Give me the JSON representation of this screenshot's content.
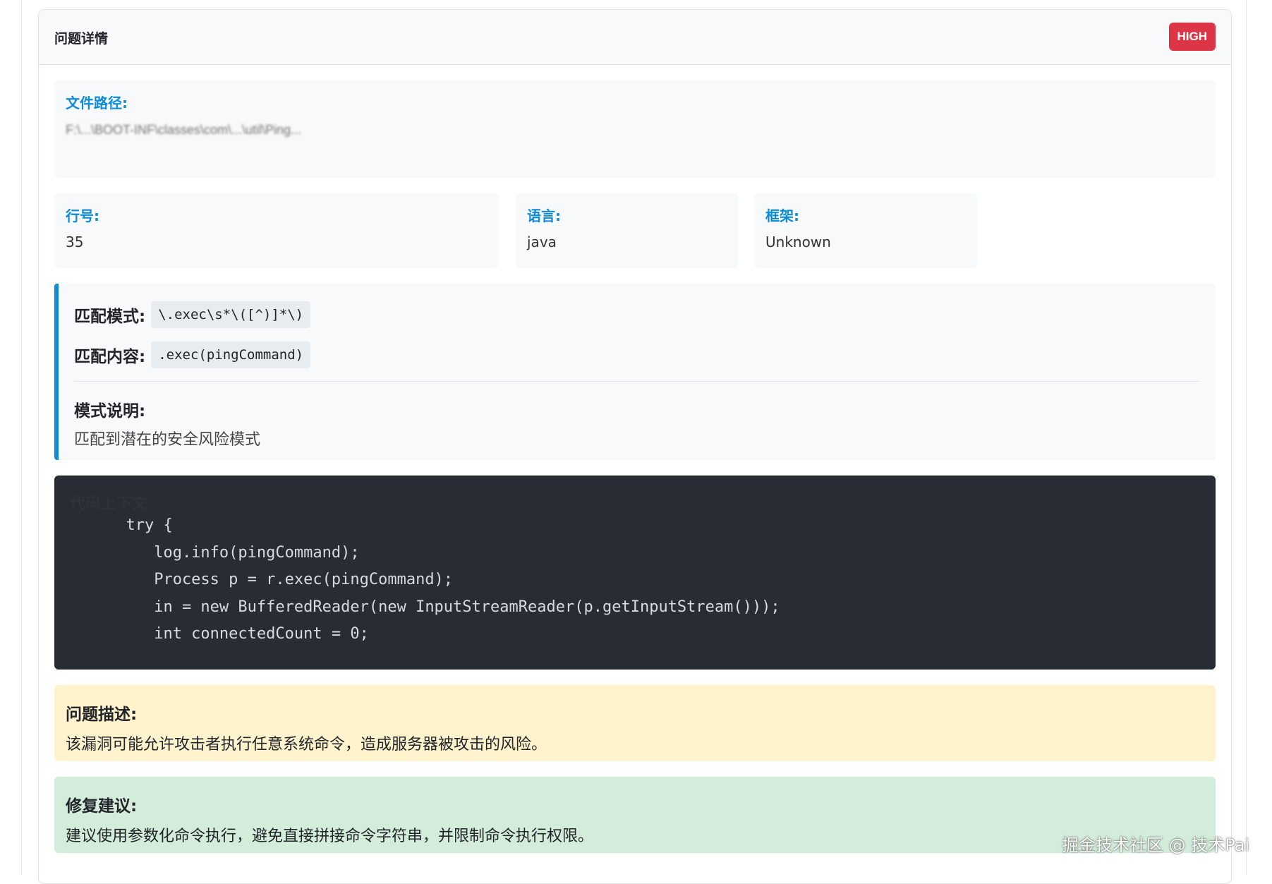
{
  "header": {
    "title": "问题详情",
    "severity": "HIGH"
  },
  "file": {
    "label": "文件路径:",
    "value": "F:\\...\\BOOT-INF\\classes\\com\\...\\util\\Ping..."
  },
  "meta": {
    "line_label": "行号:",
    "line_value": "35",
    "language_label": "语言:",
    "language_value": "java",
    "framework_label": "框架:",
    "framework_value": "Unknown"
  },
  "pattern": {
    "pattern_label": "匹配模式:",
    "pattern_value": "\\.exec\\s*\\([^)]*\\)",
    "content_label": "匹配内容:",
    "content_value": ".exec(pingCommand)",
    "explain_label": "模式说明:",
    "explain_text": "匹配到潜在的安全风险模式"
  },
  "code": {
    "title": "代码上下文",
    "lines": [
      "      try {",
      "         log.info(pingCommand);",
      "         Process p = r.exec(pingCommand);",
      "         in = new BufferedReader(new InputStreamReader(p.getInputStream()));",
      "         int connectedCount = 0;"
    ]
  },
  "description": {
    "label": "问题描述:",
    "text": "该漏洞可能允许攻击者执行任意系统命令，造成服务器被攻击的风险。"
  },
  "fix": {
    "label": "修复建议:",
    "text": "建议使用参数化命令执行，避免直接拼接命令字符串，并限制命令执行权限。"
  },
  "watermark": "掘金技术社区 @ 技术Pai",
  "colors": {
    "accent": "#0d8bd9",
    "severity_high": "#dc3545",
    "code_bg": "#282c34",
    "warning_bg": "#fff3cd",
    "success_bg": "#d4edda"
  }
}
